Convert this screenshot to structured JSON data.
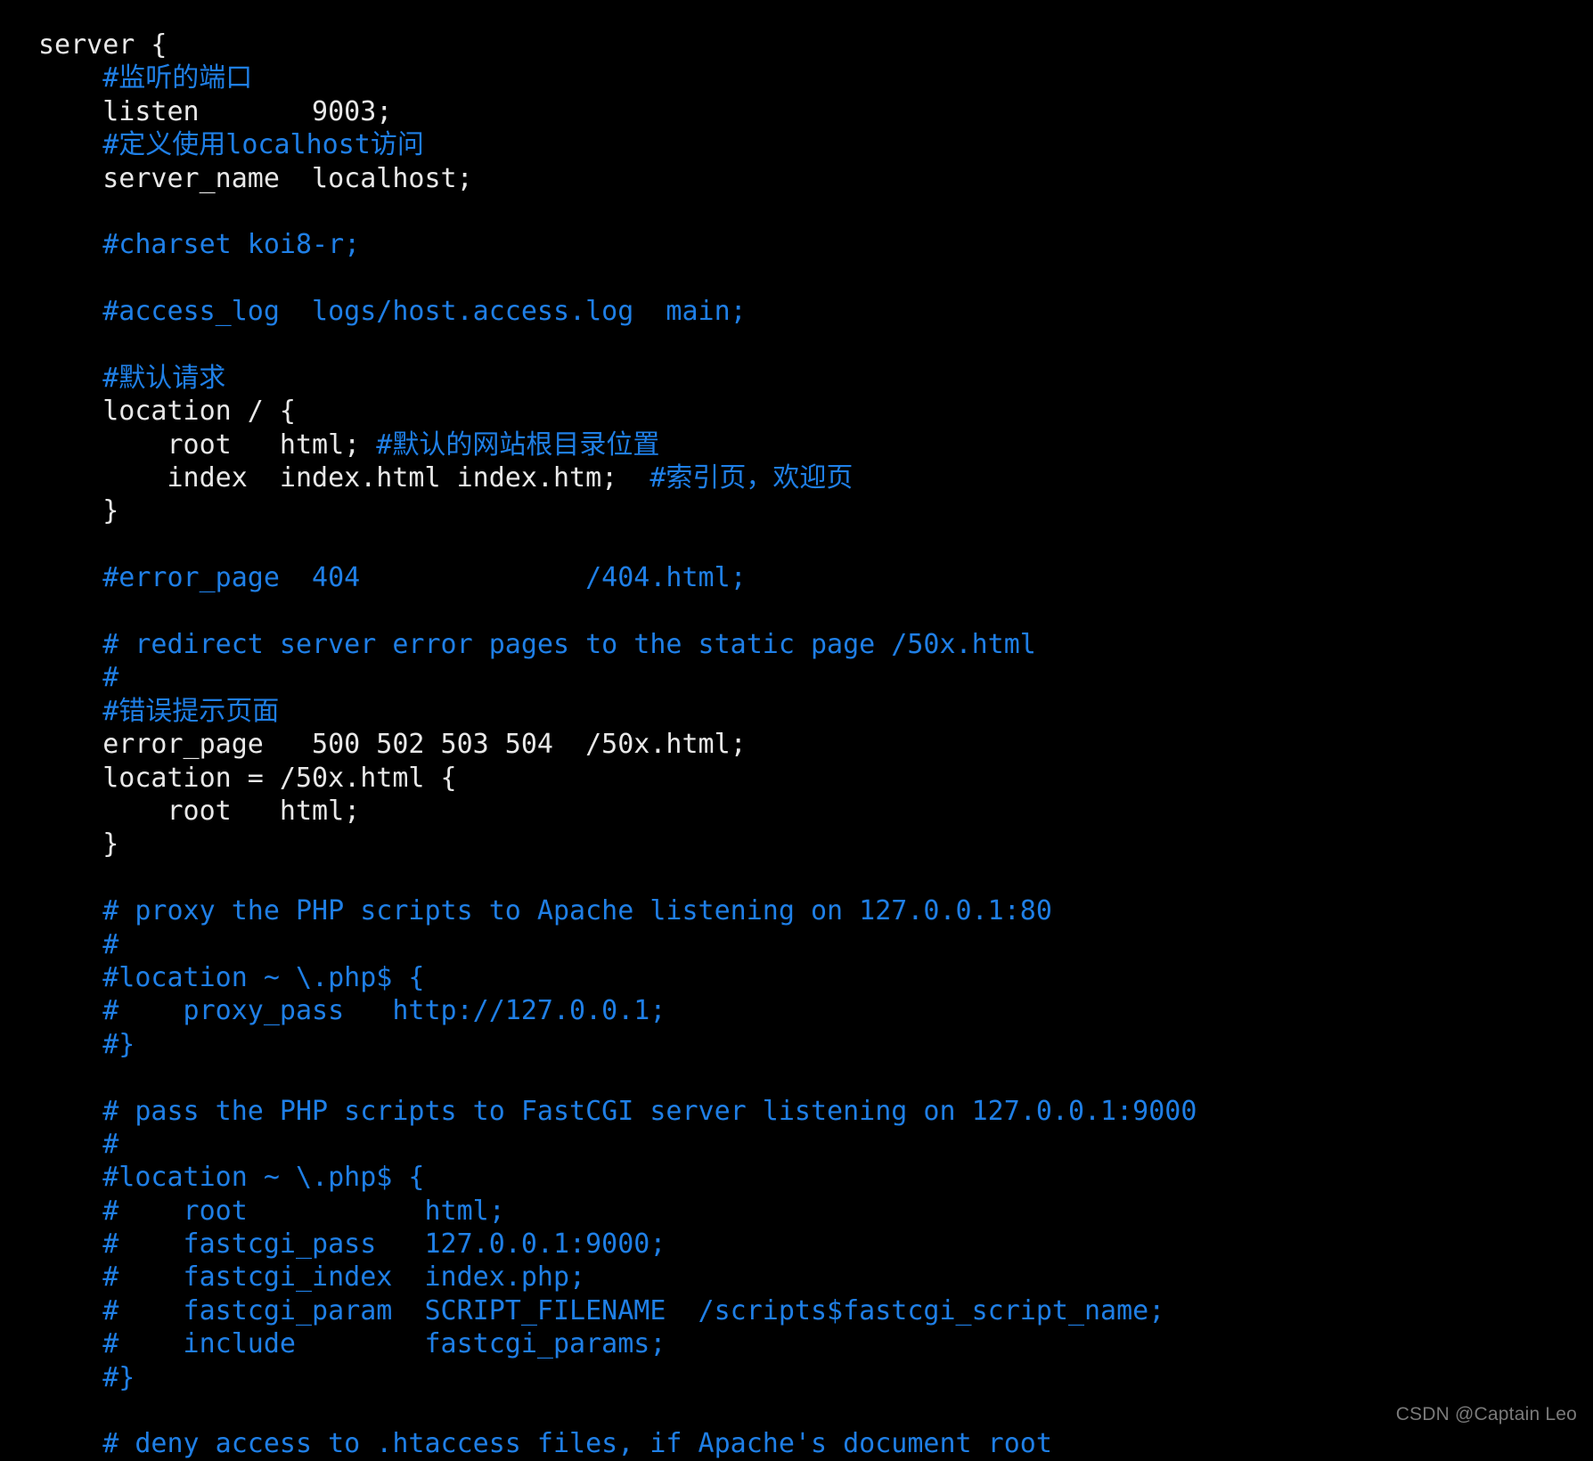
{
  "viewer": {
    "background_color": "#000000",
    "plain_color": "#e8e8e8",
    "comment_color": "#1f7fe6",
    "watermark": "CSDN @Captain Leo"
  },
  "code": {
    "language": "nginx",
    "lines": [
      {
        "indent": 0,
        "segments": [
          {
            "type": "plain",
            "text": "server {"
          }
        ]
      },
      {
        "indent": 1,
        "segments": [
          {
            "type": "comment",
            "text": "#监听的端口"
          }
        ]
      },
      {
        "indent": 1,
        "segments": [
          {
            "type": "plain",
            "text": "listen       9003;"
          }
        ]
      },
      {
        "indent": 1,
        "segments": [
          {
            "type": "comment",
            "text": "#定义使用localhost访问"
          }
        ]
      },
      {
        "indent": 1,
        "segments": [
          {
            "type": "plain",
            "text": "server_name  localhost;"
          }
        ]
      },
      {
        "indent": 0,
        "segments": []
      },
      {
        "indent": 1,
        "segments": [
          {
            "type": "comment",
            "text": "#charset koi8-r;"
          }
        ]
      },
      {
        "indent": 0,
        "segments": []
      },
      {
        "indent": 1,
        "segments": [
          {
            "type": "comment",
            "text": "#access_log  logs/host.access.log  main;"
          }
        ]
      },
      {
        "indent": 0,
        "segments": []
      },
      {
        "indent": 1,
        "segments": [
          {
            "type": "comment",
            "text": "#默认请求"
          }
        ]
      },
      {
        "indent": 1,
        "segments": [
          {
            "type": "plain",
            "text": "location / {"
          }
        ]
      },
      {
        "indent": 2,
        "segments": [
          {
            "type": "plain",
            "text": "root   html; "
          },
          {
            "type": "comment",
            "text": "#默认的网站根目录位置"
          }
        ]
      },
      {
        "indent": 2,
        "segments": [
          {
            "type": "plain",
            "text": "index  index.html index.htm;  "
          },
          {
            "type": "comment",
            "text": "#索引页，欢迎页"
          }
        ]
      },
      {
        "indent": 1,
        "segments": [
          {
            "type": "plain",
            "text": "}"
          }
        ]
      },
      {
        "indent": 0,
        "segments": []
      },
      {
        "indent": 1,
        "segments": [
          {
            "type": "comment",
            "text": "#error_page  404              /404.html;"
          }
        ]
      },
      {
        "indent": 0,
        "segments": []
      },
      {
        "indent": 1,
        "segments": [
          {
            "type": "comment",
            "text": "# redirect server error pages to the static page /50x.html"
          }
        ]
      },
      {
        "indent": 1,
        "segments": [
          {
            "type": "comment",
            "text": "#"
          }
        ]
      },
      {
        "indent": 1,
        "segments": [
          {
            "type": "comment",
            "text": "#错误提示页面"
          }
        ]
      },
      {
        "indent": 1,
        "segments": [
          {
            "type": "plain",
            "text": "error_page   500 502 503 504  /50x.html;"
          }
        ]
      },
      {
        "indent": 1,
        "segments": [
          {
            "type": "plain",
            "text": "location = /50x.html {"
          }
        ]
      },
      {
        "indent": 2,
        "segments": [
          {
            "type": "plain",
            "text": "root   html;"
          }
        ]
      },
      {
        "indent": 1,
        "segments": [
          {
            "type": "plain",
            "text": "}"
          }
        ]
      },
      {
        "indent": 0,
        "segments": []
      },
      {
        "indent": 1,
        "segments": [
          {
            "type": "comment",
            "text": "# proxy the PHP scripts to Apache listening on 127.0.0.1:80"
          }
        ]
      },
      {
        "indent": 1,
        "segments": [
          {
            "type": "comment",
            "text": "#"
          }
        ]
      },
      {
        "indent": 1,
        "segments": [
          {
            "type": "comment",
            "text": "#location ~ \\.php$ {"
          }
        ]
      },
      {
        "indent": 1,
        "segments": [
          {
            "type": "comment",
            "text": "#    proxy_pass   http://127.0.0.1;"
          }
        ]
      },
      {
        "indent": 1,
        "segments": [
          {
            "type": "comment",
            "text": "#}"
          }
        ]
      },
      {
        "indent": 0,
        "segments": []
      },
      {
        "indent": 1,
        "segments": [
          {
            "type": "comment",
            "text": "# pass the PHP scripts to FastCGI server listening on 127.0.0.1:9000"
          }
        ]
      },
      {
        "indent": 1,
        "segments": [
          {
            "type": "comment",
            "text": "#"
          }
        ]
      },
      {
        "indent": 1,
        "segments": [
          {
            "type": "comment",
            "text": "#location ~ \\.php$ {"
          }
        ]
      },
      {
        "indent": 1,
        "segments": [
          {
            "type": "comment",
            "text": "#    root           html;"
          }
        ]
      },
      {
        "indent": 1,
        "segments": [
          {
            "type": "comment",
            "text": "#    fastcgi_pass   127.0.0.1:9000;"
          }
        ]
      },
      {
        "indent": 1,
        "segments": [
          {
            "type": "comment",
            "text": "#    fastcgi_index  index.php;"
          }
        ]
      },
      {
        "indent": 1,
        "segments": [
          {
            "type": "comment",
            "text": "#    fastcgi_param  SCRIPT_FILENAME  /scripts$fastcgi_script_name;"
          }
        ]
      },
      {
        "indent": 1,
        "segments": [
          {
            "type": "comment",
            "text": "#    include        fastcgi_params;"
          }
        ]
      },
      {
        "indent": 1,
        "segments": [
          {
            "type": "comment",
            "text": "#}"
          }
        ]
      },
      {
        "indent": 0,
        "segments": []
      },
      {
        "indent": 1,
        "segments": [
          {
            "type": "comment",
            "text": "# deny access to .htaccess files, if Apache's document root"
          }
        ]
      }
    ]
  }
}
